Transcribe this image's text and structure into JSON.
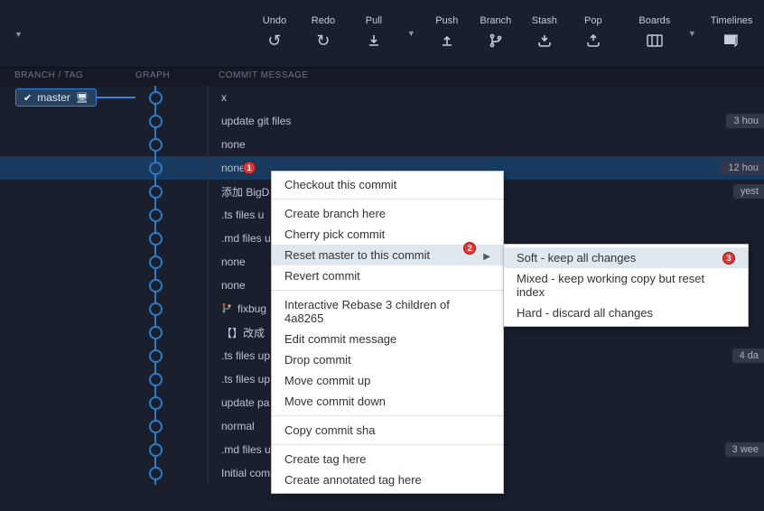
{
  "toolbar": {
    "undo": "Undo",
    "redo": "Redo",
    "pull": "Pull",
    "push": "Push",
    "branch": "Branch",
    "stash": "Stash",
    "pop": "Pop",
    "boards": "Boards",
    "timelines": "Timelines"
  },
  "columns": {
    "branch_tag": "BRANCH / TAG",
    "graph": "GRAPH",
    "commit_message": "COMMIT MESSAGE"
  },
  "branch_badge": {
    "name": "master"
  },
  "commits": [
    {
      "msg": "x",
      "time": ""
    },
    {
      "msg": "update git files",
      "time": "3 hou"
    },
    {
      "msg": "none",
      "time": ""
    },
    {
      "msg": "none",
      "time": "12 hou",
      "selected": true,
      "callout": 1
    },
    {
      "msg": "添加 BigD",
      "time": "yest"
    },
    {
      "msg": ".ts files u",
      "time": ""
    },
    {
      "msg": ".md files u",
      "time": ""
    },
    {
      "msg": "none",
      "time": ""
    },
    {
      "msg": "none",
      "time": ""
    },
    {
      "msg": "fixbug",
      "time": "",
      "icon": "branch"
    },
    {
      "msg": "【】改成",
      "time": ""
    },
    {
      "msg": ".ts files up",
      "time": "4 da"
    },
    {
      "msg": ".ts files up",
      "time": ""
    },
    {
      "msg": "update pa",
      "time": ""
    },
    {
      "msg": "normal",
      "time": ""
    },
    {
      "msg": ".md files u",
      "time": "3 wee"
    },
    {
      "msg": "Initial commit",
      "time": ""
    }
  ],
  "ctx": {
    "checkout": "Checkout this commit",
    "create_branch": "Create branch here",
    "cherry_pick": "Cherry pick commit",
    "reset": "Reset master to this commit",
    "revert": "Revert commit",
    "rebase": "Interactive Rebase 3 children of 4a8265",
    "edit_msg": "Edit commit message",
    "drop": "Drop commit",
    "move_up": "Move commit up",
    "move_down": "Move commit down",
    "copy_sha": "Copy commit sha",
    "create_tag": "Create tag here",
    "create_ann_tag": "Create annotated tag here"
  },
  "reset_sub": {
    "soft": "Soft - keep all changes",
    "mixed": "Mixed - keep working copy but reset index",
    "hard": "Hard - discard all changes"
  },
  "callouts": {
    "c2": 2,
    "c3": 3
  }
}
